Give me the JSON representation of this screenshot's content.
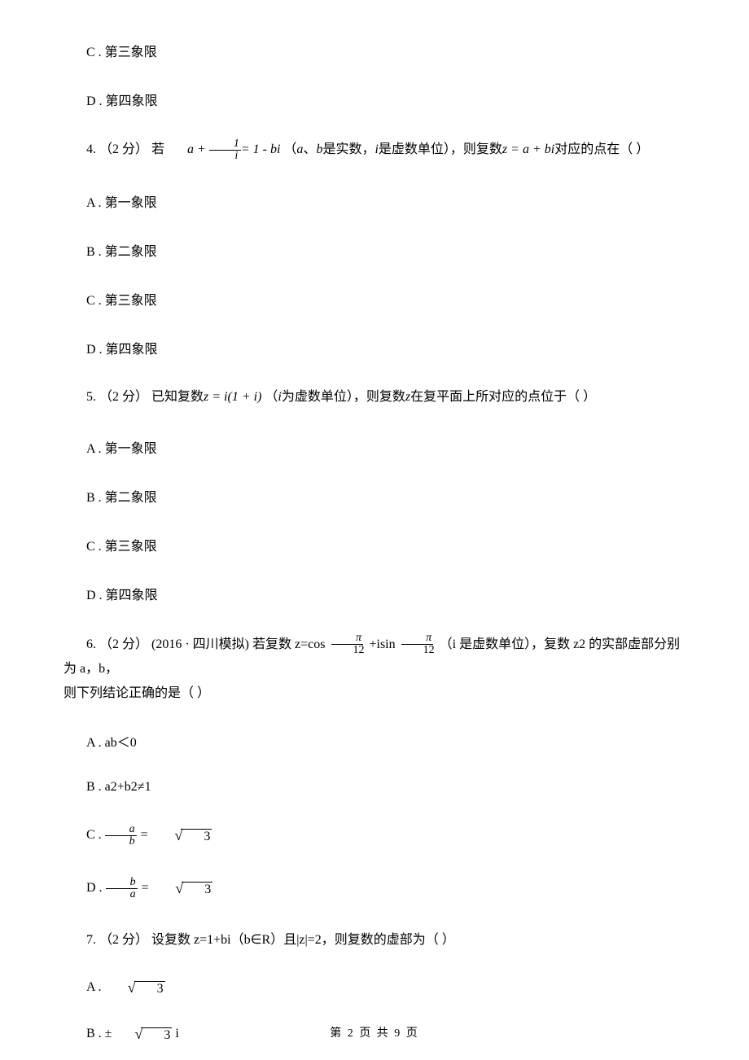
{
  "q3": {
    "options": {
      "C": "C .  第三象限",
      "D": "D .  第四象限"
    }
  },
  "q4": {
    "num": "4.",
    "points": "（2 分）",
    "stem_before": " 若",
    "formula_tail": "= 1 - bi",
    "stem_mid1": " （",
    "a_var": "a",
    "stem_sep": "、",
    "b_var": "b",
    "stem_mid2": "是实数，",
    "i_var": "i",
    "stem_mid3": "是虚数单位），则复数",
    "z_expr": "z = a + bi",
    "stem_after": "对应的点在（     ）",
    "frac_num": "1",
    "frac_den": "i",
    "a_plus": "a + ",
    "options": {
      "A": "A .  第一象限",
      "B": "B .  第二象限",
      "C": "C .  第三象限",
      "D": "D .  第四象限"
    }
  },
  "q5": {
    "num": "5.",
    "points": "（2 分）",
    "stem_before": " 已知复数",
    "z_expr": "z = i(1 + i)",
    "stem_mid1": "  （",
    "i_var": "i",
    "stem_mid2": "为虚数单位），则复数",
    "z_var": "z",
    "stem_after": "在复平面上所对应的点位于（     ）",
    "options": {
      "A": "A .  第一象限",
      "B": "B .  第二象限",
      "C": "C .  第三象限",
      "D": "D .  第四象限"
    }
  },
  "q6": {
    "num": "6.",
    "points": "（2 分）",
    "source": "(2016 · 四川模拟) ",
    "stem_before": "若复数 z=cos ",
    "pi": "π",
    "twelve": "12",
    "stem_mid": " +isin ",
    "stem_after": " （i 是虚数单位），复数 z2 的实部虚部分别为 a，b，",
    "stem_line2": "则下列结论正确的是（     ）",
    "optA": "A .  ab＜0",
    "optB": "B .  a2+b2≠1",
    "optC_pre": "C .  ",
    "optC_a": "a",
    "optC_b": "b",
    "optC_eq": " = ",
    "optC_rad": "3",
    "optD_pre": "D .  ",
    "optD_b": "b",
    "optD_a": "a",
    "optD_eq": " = ",
    "optD_rad": "3"
  },
  "q7": {
    "num": "7.",
    "points": "（2 分）",
    "stem": " 设复数 z=1+bi（b∈R）且|z|=2，则复数的虚部为（     ）",
    "optA_pre": "A .  ",
    "optA_rad": "3",
    "optB_pre": "B .  ±",
    "optB_rad": "3",
    "optB_suf": " i"
  },
  "footer": "第 2 页 共 9 页"
}
